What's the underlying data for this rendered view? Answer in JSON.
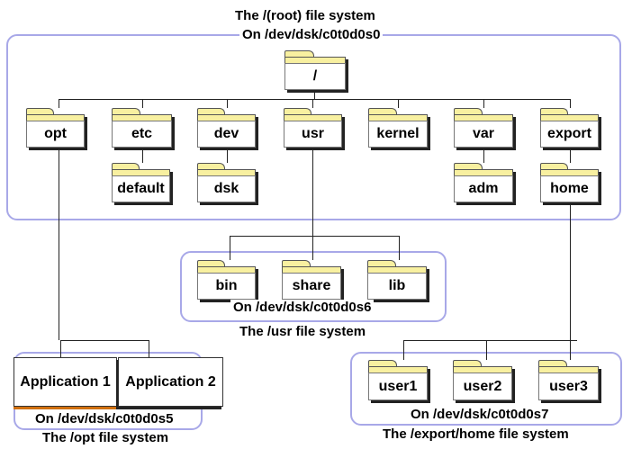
{
  "root": {
    "title": "The /(root) file system",
    "device": "On /dev/dsk/c0t0d0s0",
    "top": "/",
    "level1": [
      "opt",
      "etc",
      "dev",
      "usr",
      "kernel",
      "var",
      "export"
    ],
    "level2": {
      "etc": "default",
      "dev": "dsk",
      "var": "adm",
      "export": "home"
    }
  },
  "usr": {
    "folders": [
      "bin",
      "share",
      "lib"
    ],
    "device": "On /dev/dsk/c0t0d0s6",
    "title": "The /usr file system"
  },
  "opt": {
    "apps": [
      "Application 1",
      "Application 2"
    ],
    "device": "On /dev/dsk/c0t0d0s5",
    "title": "The /opt file system"
  },
  "home": {
    "folders": [
      "user1",
      "user2",
      "user3"
    ],
    "device": "On /dev/dsk/c0t0d0s7",
    "title": "The /export/home file system"
  },
  "colors": {
    "folder": "#f8f0a0",
    "boundary": "#a8a8e8"
  }
}
